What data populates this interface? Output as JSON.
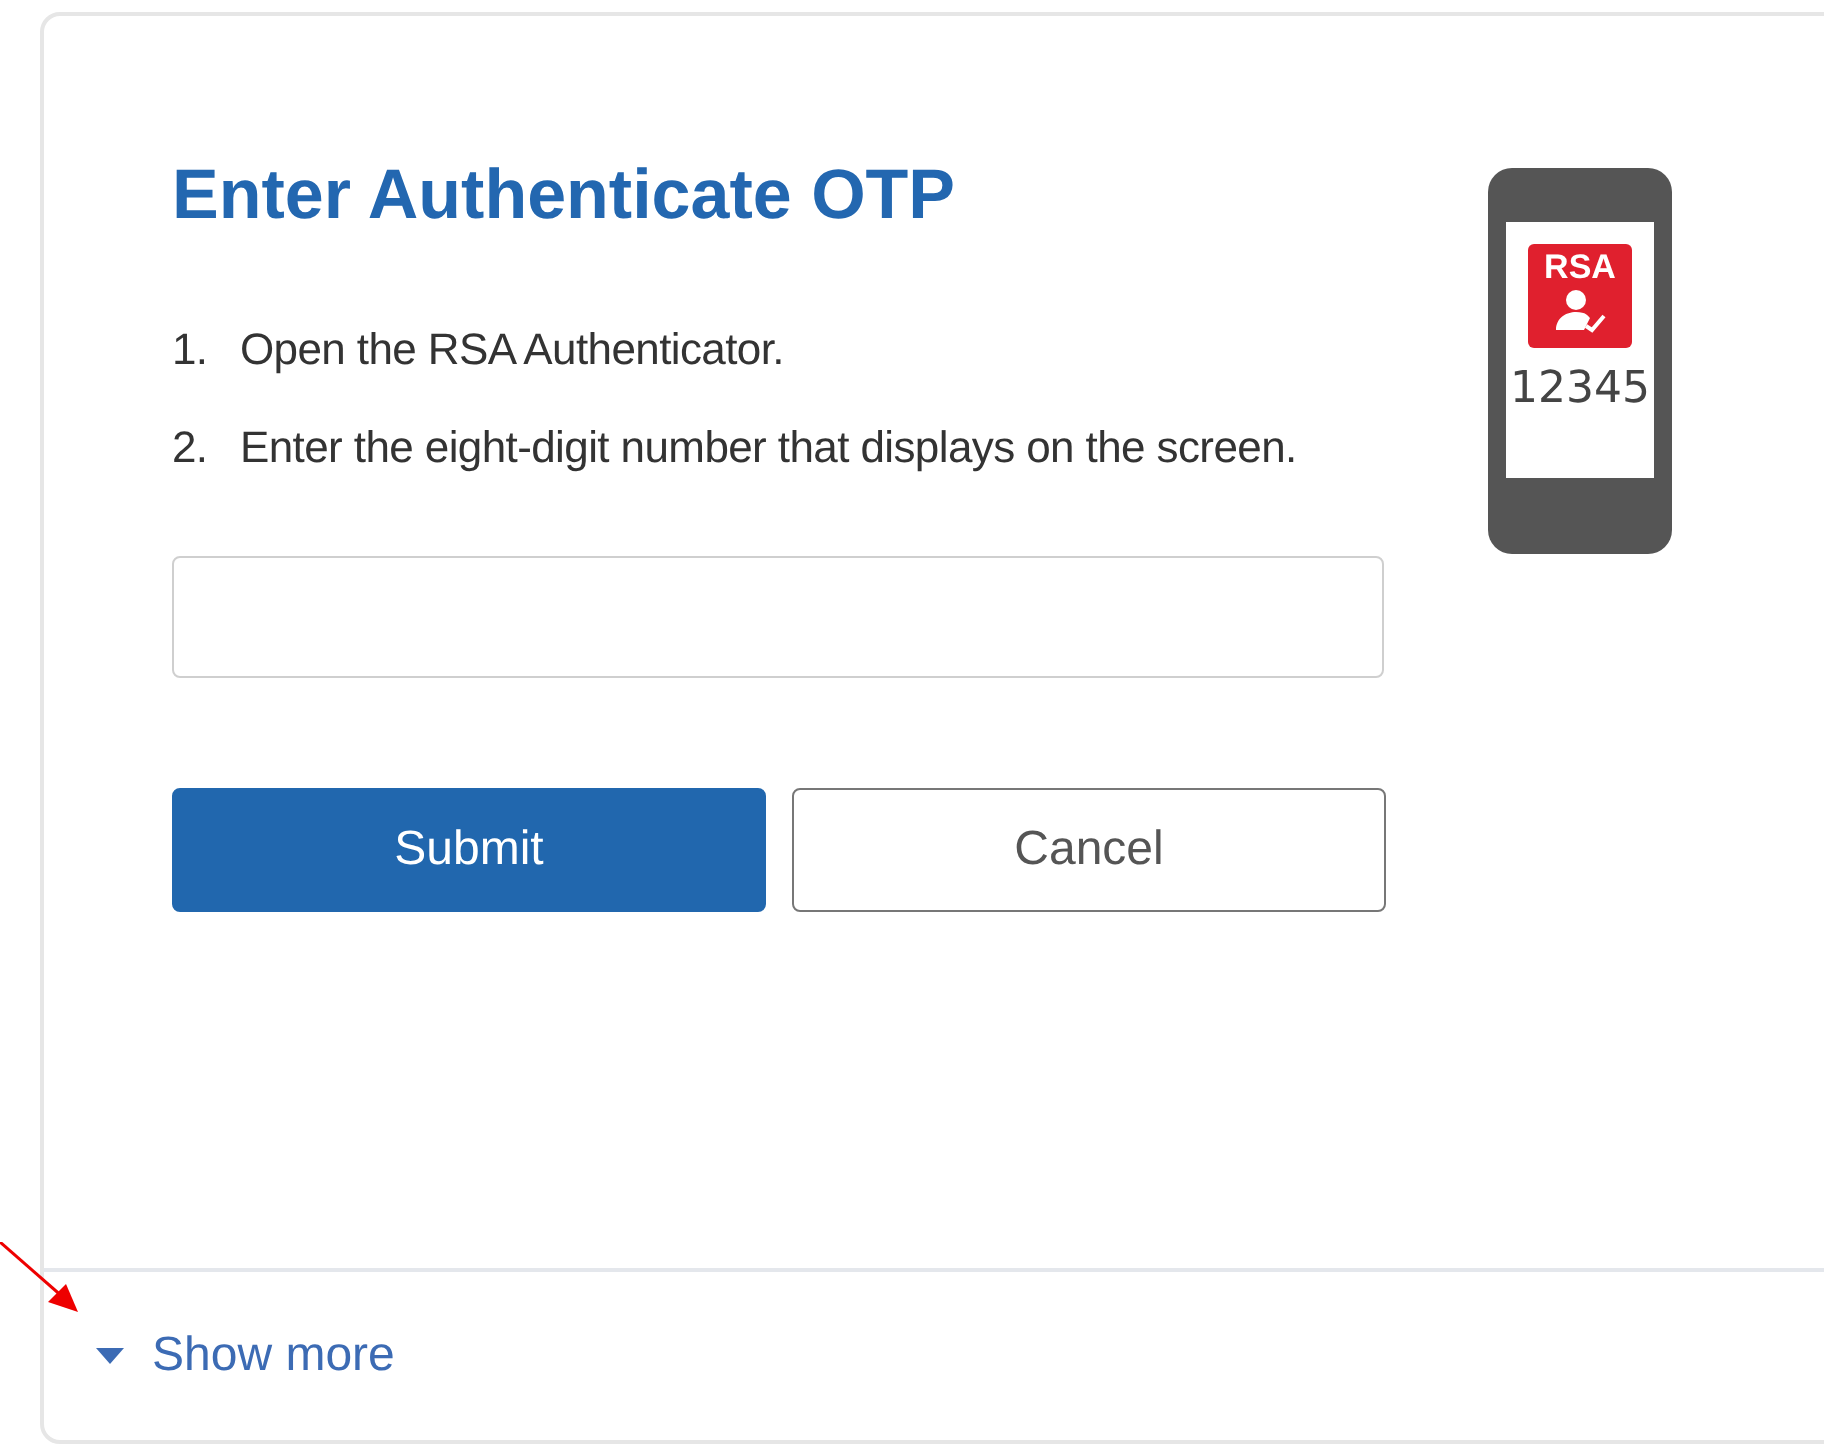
{
  "title": "Enter Authenticate OTP",
  "steps": [
    {
      "number": "1.",
      "text": "Open the RSA Authenticator."
    },
    {
      "number": "2.",
      "text": "Enter the eight-digit number that displays on the screen."
    }
  ],
  "phone_illustration": {
    "logo_text": "RSA",
    "code": "12345"
  },
  "buttons": [
    {
      "label": "Submit",
      "kind": "primary"
    },
    {
      "label": "Cancel",
      "kind": "secondary"
    }
  ],
  "show_more": {
    "label": "Show more",
    "expanded": false
  }
}
